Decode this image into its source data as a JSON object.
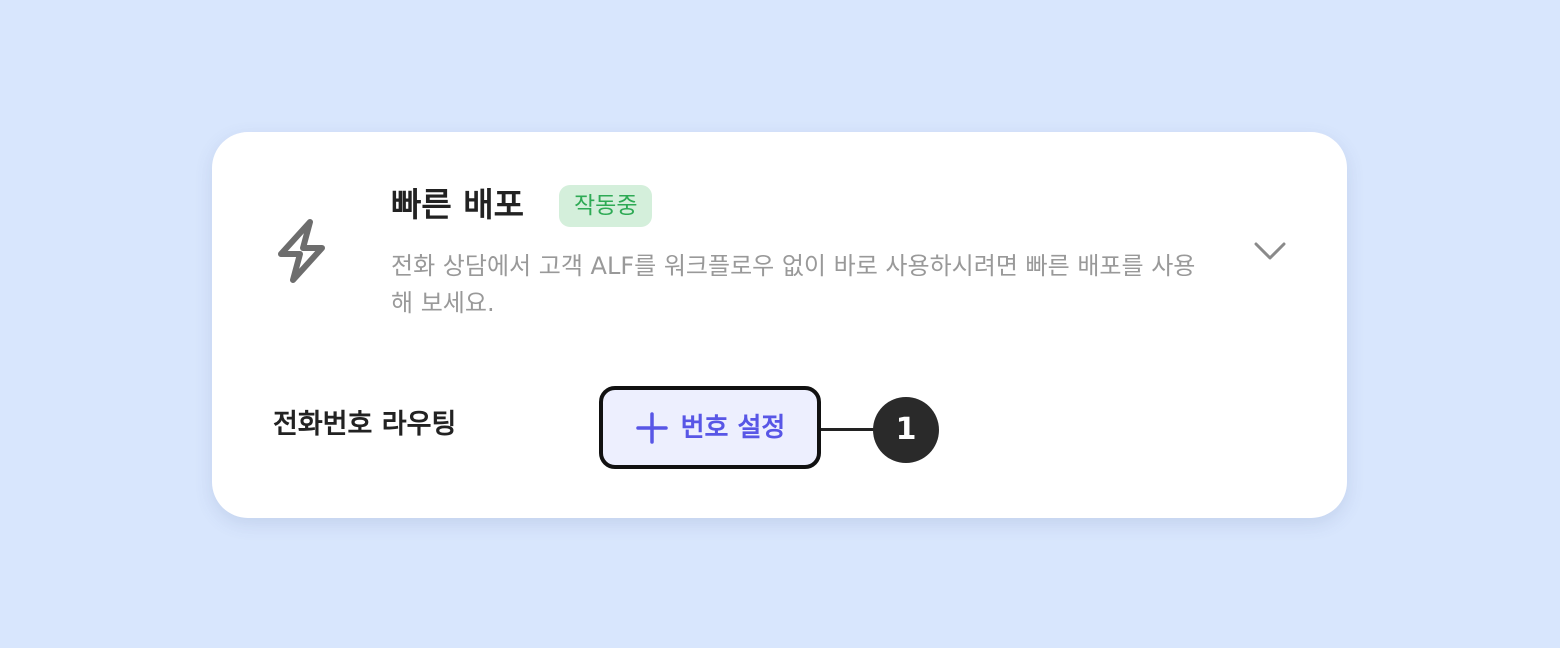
{
  "card": {
    "icon": "lightning-bolt-icon",
    "title": "빠른 배포",
    "status_badge": "작동중",
    "description": "전화 상담에서 고객 ALF를 워크플로우 없이 바로 사용하시려면 빠른 배포를 사용해 보세요.",
    "expand_icon": "chevron-down-icon"
  },
  "routing": {
    "label": "전화번호 라우팅",
    "button_icon": "plus-icon",
    "button_label": "번호 설정"
  },
  "callout": {
    "number": "1"
  },
  "colors": {
    "background": "#d8e6fd",
    "badge_bg": "#d4efdb",
    "badge_text": "#2eaa55",
    "button_bg": "#edeffe",
    "button_text": "#5856e6",
    "callout_bg": "#2a2a2a"
  }
}
